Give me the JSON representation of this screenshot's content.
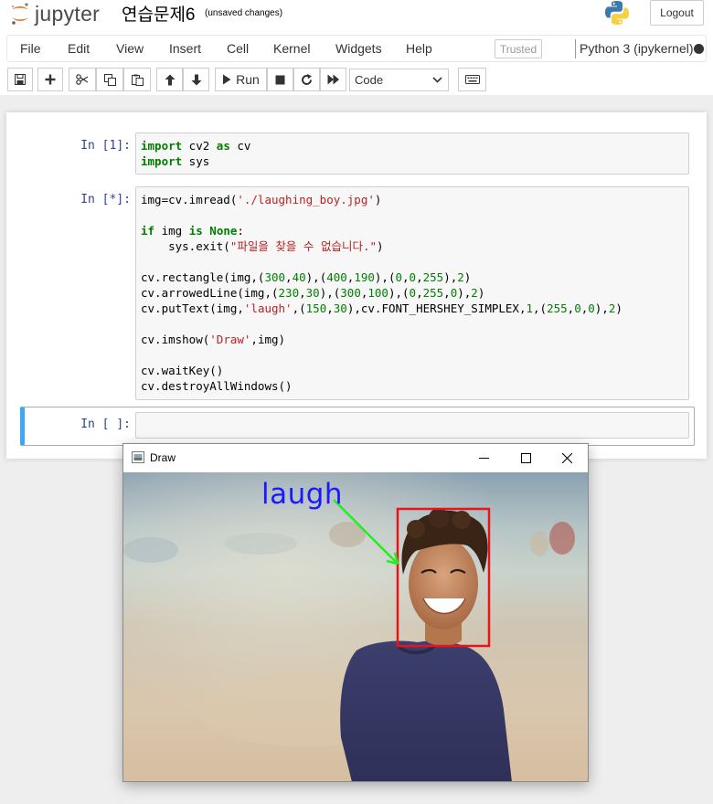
{
  "header": {
    "logo_text": "jupyter",
    "notebook_title": "연습문제6",
    "save_status": "(unsaved changes)",
    "logout_label": "Logout"
  },
  "menubar": {
    "items": [
      "File",
      "Edit",
      "View",
      "Insert",
      "Cell",
      "Kernel",
      "Widgets",
      "Help"
    ],
    "trusted_label": "Trusted",
    "kernel_name": "Python 3 (ipykernel)"
  },
  "toolbar": {
    "icons": [
      "save-icon",
      "plus-icon",
      "cut-icon",
      "copy-icon",
      "paste-icon",
      "arrow-up-icon",
      "arrow-down-icon",
      "play-icon",
      "stop-icon",
      "restart-icon",
      "fast-forward-icon",
      "keyboard-icon"
    ],
    "run_label": "Run",
    "cell_type": "Code"
  },
  "cells": [
    {
      "prompt": "In [1]:",
      "lines": [
        "import cv2 as cv",
        "import sys"
      ]
    },
    {
      "prompt": "In [*]:",
      "lines": [
        "img=cv.imread('./laughing_boy.jpg')",
        "",
        "if img is None:",
        "    sys.exit(\"파일을 찾을 수 없습니다.\")",
        "",
        "cv.rectangle(img,(300,40),(400,190),(0,0,255),2)",
        "cv.arrowedLine(img,(230,30),(300,100),(0,255,0),2)",
        "cv.putText(img,'laugh',(150,30),cv.FONT_HERSHEY_SIMPLEX,1,(255,0,0),2)",
        "",
        "cv.imshow('Draw',img)",
        "",
        "cv.waitKey()",
        "cv.destroyAllWindows()"
      ]
    },
    {
      "prompt": "In [ ]:",
      "lines": []
    }
  ],
  "draw_window": {
    "title": "Draw",
    "overlay_text": "laugh"
  },
  "colors": {
    "prompt": "#303f9f",
    "keyword": "#008000",
    "string": "#ba2121",
    "number": "#008000",
    "selected_cell_border": "#42a5f5",
    "rectangle": "#e8141a",
    "arrow": "#22ee22",
    "overlay_text": "#1a1aff"
  }
}
